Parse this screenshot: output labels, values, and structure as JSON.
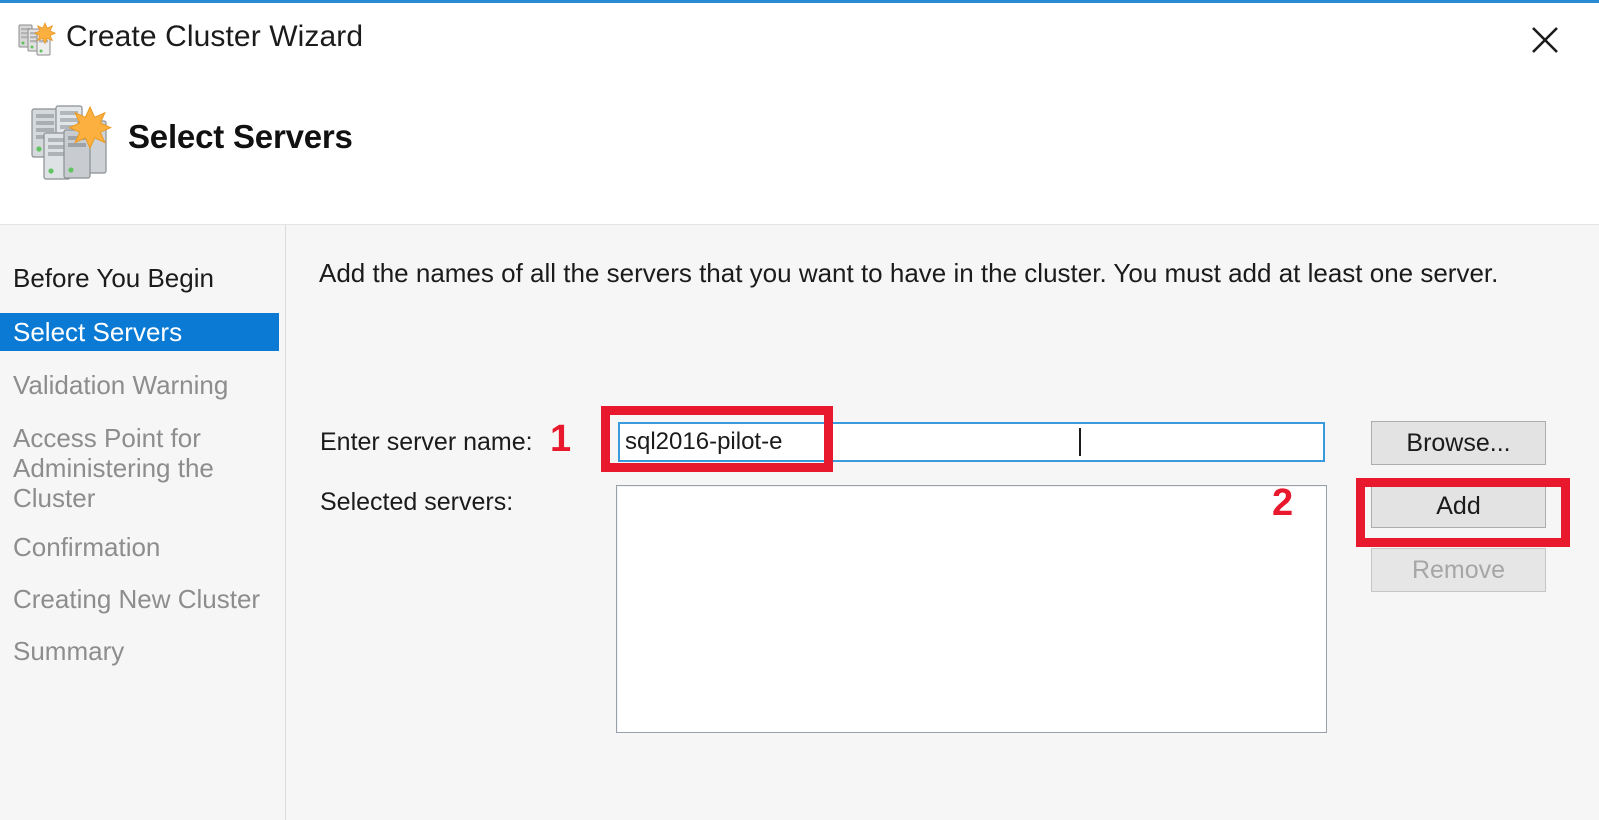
{
  "window": {
    "title": "Create Cluster Wizard",
    "title_icon": "cluster-servers-icon",
    "close_label": "✕",
    "accent_color": "#2a8ad4"
  },
  "banner": {
    "heading": "Select Servers",
    "icon": "servers-stack-icon"
  },
  "sidebar": {
    "items": [
      {
        "label": "Before You Begin",
        "state": "done"
      },
      {
        "label": "Select Servers",
        "state": "active"
      },
      {
        "label": "Validation Warning",
        "state": "pending"
      },
      {
        "label": "Access Point for Administering the Cluster",
        "state": "pending"
      },
      {
        "label": "Confirmation",
        "state": "pending"
      },
      {
        "label": "Creating New Cluster",
        "state": "pending"
      },
      {
        "label": "Summary",
        "state": "pending"
      }
    ],
    "active_color": "#0a7ad4"
  },
  "main": {
    "intro": "Add the names of all the servers that you want to have in the cluster. You must add at least one server.",
    "server_name_label": "Enter server name:",
    "server_name_value": "sql2016-pilot-e",
    "server_name_placeholder": "",
    "selected_servers_label": "Selected servers:",
    "selected_servers": [],
    "buttons": {
      "browse": "Browse...",
      "add": "Add",
      "remove": "Remove"
    }
  },
  "annotations": {
    "color": "#e8192c",
    "steps": [
      {
        "number": "1",
        "target": "server-name-input"
      },
      {
        "number": "2",
        "target": "add-button"
      }
    ]
  }
}
